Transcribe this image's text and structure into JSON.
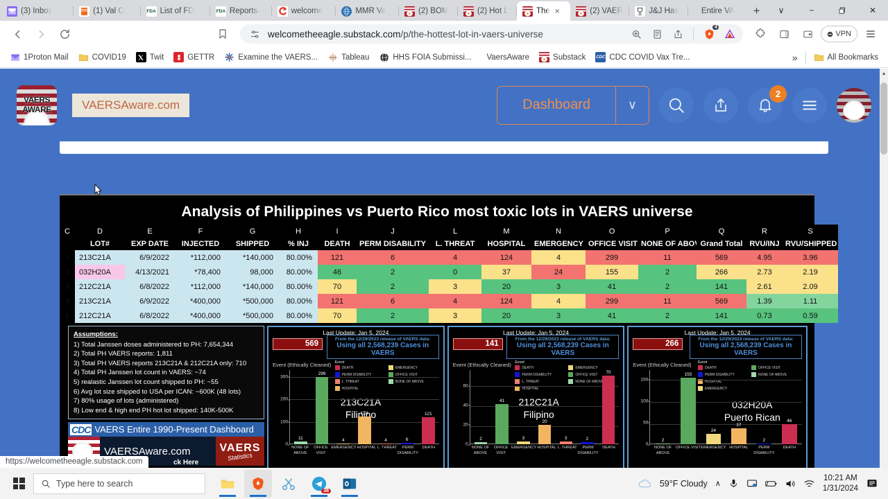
{
  "browser": {
    "tabs": [
      {
        "label": "(3) Inbox",
        "favicon": "proton-mail-icon",
        "color": "#8a6df0",
        "active": false
      },
      {
        "label": "(1) Val O",
        "favicon": "bookmark-icon",
        "color": "#f06a1e",
        "active": false
      },
      {
        "label": "List of FD",
        "favicon": "fda-icon",
        "color": "#1c6b3c",
        "active": false
      },
      {
        "label": "Reports-",
        "favicon": "fda-icon",
        "color": "#1c6b3c",
        "active": false
      },
      {
        "label": "welcome",
        "favicon": "substack-c-icon",
        "color": "#e03b2f",
        "active": false
      },
      {
        "label": "MMR Va",
        "favicon": "globe-icon",
        "color": "#2b6fb0",
        "active": false
      },
      {
        "label": "(2) BOM",
        "favicon": "eagle-icon",
        "color": "#8c3a1e",
        "active": false
      },
      {
        "label": "(2) Hot L",
        "favicon": "eagle-icon",
        "color": "#8c3a1e",
        "active": false
      },
      {
        "label": "The",
        "favicon": "eagle-icon",
        "color": "#8c3a1e",
        "active": true
      },
      {
        "label": "(2) VAER",
        "favicon": "eagle-icon",
        "color": "#8c3a1e",
        "active": false
      },
      {
        "label": "J&J Has",
        "favicon": "trophy-icon",
        "color": "#444444",
        "active": false
      },
      {
        "label": "Entire VA",
        "favicon": "none",
        "color": "#999999",
        "active": false
      }
    ],
    "tab_close_label": "×",
    "new_tab_label": "+",
    "window_controls": {
      "tablist": "∨",
      "minimize": "−",
      "restore": "❐",
      "close": "✕"
    },
    "nav": {
      "back": "‹",
      "forward": "›",
      "reload": "⟳",
      "bookmark": "🔖"
    },
    "omnibox": {
      "url_domain": "welcometheeagle.substack.com",
      "url_path": "/p/the-hottest-lot-in-vaers-universe",
      "permissions_icon": "tune-icon",
      "zoom_icon": "zoom-in-icon",
      "reading_icon": "reading-list-icon",
      "share_icon": "share-icon",
      "brave_shields_icon": "brave-lion-icon",
      "shields_count": "4",
      "extension_icon": "brave-triangle-icon"
    },
    "toolbar_right": {
      "extensions": "puzzle-icon",
      "sidebar": "sidebar-panel-icon",
      "wallet": "wallet-icon",
      "vpn_label": "VPN",
      "menu": "hamburger-menu-icon"
    },
    "bookmarks": [
      {
        "label": "1Proton Mail",
        "icon": "proton-mail-icon",
        "color": "#8a6df0"
      },
      {
        "label": "COVID19",
        "icon": "folder-icon",
        "color": "#f0c14b"
      },
      {
        "label": "Twit",
        "icon": "x-twitter-icon",
        "color": "#000000"
      },
      {
        "label": "GETTR",
        "icon": "gettr-icon",
        "color": "#e0242b"
      },
      {
        "label": "Examine the VAERS...",
        "icon": "asterisk-icon",
        "color": "#2b5fa8"
      },
      {
        "label": "Tableau",
        "icon": "tableau-icon",
        "color": "#e8762d"
      },
      {
        "label": "HHS FOIA Submissi...",
        "icon": "globe-icon",
        "color": "#2d2d2d"
      },
      {
        "label": "VaersAware",
        "icon": "none",
        "color": "#888888"
      },
      {
        "label": "Substack",
        "icon": "eagle-icon",
        "color": "#8c3a1e"
      },
      {
        "label": "CDC COVID Vax Tre...",
        "icon": "cdc-icon",
        "color": "#2b5fa8"
      }
    ],
    "bookmarks_overflow": "»",
    "all_bookmarks_label": "All Bookmarks",
    "status_url": "https://welcometheeagle.substack.com"
  },
  "site": {
    "publication_logo_text_line1": "VAERS",
    "publication_logo_text_line2": "AWARE",
    "link_tooltip": "VAERSAware.com",
    "dashboard_label": "Dashboard",
    "dashboard_caret": "∨",
    "search_icon": "search-icon",
    "share_icon": "share-up-icon",
    "bell_icon": "bell-icon",
    "bell_badge": "2",
    "menu_icon": "hamburger-menu-icon",
    "avatar": "user-avatar"
  },
  "infographic": {
    "title": "Analysis of Philippines vs Puerto Rico most toxic lots in VAERS universe",
    "column_letters": [
      "C",
      "D",
      "E",
      "F",
      "G",
      "H",
      "I",
      "J",
      "L",
      "M",
      "N",
      "O",
      "P",
      "Q",
      "R",
      "S"
    ],
    "column_headers": [
      "",
      "LOT#",
      "EXP DATE",
      "INJECTED",
      "SHIPPED",
      "% INJ",
      "DEATH",
      "PERM DISABILITY",
      "L. THREAT",
      "HOSPITAL",
      "EMERGENCY",
      "OFFICE VISIT",
      "NONE OF ABOVE",
      "Grand Total",
      "RVU/INJ",
      "RVU/SHIPPED"
    ],
    "rows": [
      {
        "num": "1",
        "lot": "213C21A",
        "exp": "6/9/2022",
        "injected": "*112,000",
        "shipped": "*140,000",
        "pct": "80.00%",
        "death": "121",
        "perm": "6",
        "lthreat": "4",
        "hospital": "124",
        "emergency": "4",
        "office": "299",
        "none": "11",
        "total": "569",
        "rvu_inj": "4.95",
        "rvu_ship": "3.96"
      },
      {
        "num": "2",
        "lot": "032H20A",
        "exp": "4/13/2021",
        "injected": "*78,400",
        "shipped": "98,000",
        "pct": "80.00%",
        "death": "46",
        "perm": "2",
        "lthreat": "0",
        "hospital": "37",
        "emergency": "24",
        "office": "155",
        "none": "2",
        "total": "266",
        "rvu_inj": "2.73",
        "rvu_ship": "2.19"
      },
      {
        "num": "3",
        "lot": "212C21A",
        "exp": "6/8/2022",
        "injected": "*112,000",
        "shipped": "*140,000",
        "pct": "80.00%",
        "death": "70",
        "perm": "2",
        "lthreat": "3",
        "hospital": "20",
        "emergency": "3",
        "office": "41",
        "none": "2",
        "total": "141",
        "rvu_inj": "2.61",
        "rvu_ship": "2.09"
      },
      {
        "num": "4",
        "lot": "213C21A",
        "exp": "6/9/2022",
        "injected": "*400,000",
        "shipped": "*500,000",
        "pct": "80.00%",
        "death": "121",
        "perm": "6",
        "lthreat": "4",
        "hospital": "124",
        "emergency": "4",
        "office": "299",
        "none": "11",
        "total": "569",
        "rvu_inj": "1.39",
        "rvu_ship": "1.11"
      },
      {
        "num": "5",
        "lot": "212C21A",
        "exp": "6/8/2022",
        "injected": "*400,000",
        "shipped": "*500,000",
        "pct": "80.00%",
        "death": "70",
        "perm": "2",
        "lthreat": "3",
        "hospital": "20",
        "emergency": "3",
        "office": "41",
        "none": "2",
        "total": "141",
        "rvu_inj": "0.73",
        "rvu_ship": "0.59"
      }
    ],
    "assumptions": {
      "heading": "Assumptions:",
      "items": [
        "1) Total Janssen doses administered to PH: 7,654,344",
        "2) Total PH VAERS reports:  1,811",
        "3) Total PH VAERS reports 213C21A & 212C21A only:  710",
        "4) Total PH Janssen lot count in VAERS: ~74",
        "5)  realastic Janssen lot count shipped to PH: ~55",
        "6) Avg lot size shipped to USA per ICAN: ~600K (48 lots)",
        "7) 80% usage of lots (administered)",
        "8)  Low end & high end PH hot lot shipped:  140K-500K"
      ]
    },
    "cdc_banner": {
      "cdc_logo": "CDC",
      "title": "VAERS Entire 1990-Present Dashboard",
      "site": "VAERSAware.com",
      "click_here": "ck Here",
      "stamp_line1": "VAERS",
      "stamp_line2": "Statistics"
    }
  },
  "chart_data": [
    {
      "type": "bar",
      "title": "213C21A",
      "subtitle": "Filipino",
      "total_badge": "569",
      "last_update": "Last Update: Jan 5, 2024",
      "source_line1": "From the 12/29/2023 release of VAERS data:",
      "source_line2": "Using all 2,568,239 Cases in VAERS",
      "ylabel": "Event (Ethically Cleaned)",
      "legend_title": "Event",
      "legend": [
        "DEATH",
        "PERM DISABILITY",
        "L. THREAT",
        "HOSPITAL",
        "EMERGENCY",
        "OFFICE VISIT",
        "NONE OF ABOVE"
      ],
      "categories": [
        "NONE OF ABOVE",
        "OFFICE VISIT",
        "EMERGENCY",
        "HOSPITAL",
        "L. THREAT",
        "PERM DISABILITY",
        "DEATH"
      ],
      "values": [
        11,
        299,
        4,
        124,
        4,
        6,
        121
      ],
      "colors": [
        "#9fd9ae",
        "#5aa95f",
        "#f0d87c",
        "#f2b562",
        "#f08070",
        "#1414d8",
        "#cc2e52"
      ],
      "ylim": [
        0,
        330
      ],
      "yticks": [
        0,
        100,
        200,
        300
      ]
    },
    {
      "type": "bar",
      "title": "212C21A",
      "subtitle": "Filipino",
      "total_badge": "141",
      "last_update": "Last Update: Jan 5, 2024",
      "source_line1": "From the 12/29/2023 release of VAERS data:",
      "source_line2": "Using all 2,568,239 Cases in VAERS",
      "ylabel": "Event (Ethically Cleaned)",
      "legend_title": "Event",
      "legend": [
        "DEATH",
        "PERM DISABILITY",
        "L. THREAT",
        "HOSPITAL",
        "EMERGENCY",
        "OFFICE VISIT",
        "NONE OF ABOVE"
      ],
      "categories": [
        "NONE OF ABOVE",
        "OFFICE VISIT",
        "EMERGENCY",
        "HOSPITAL",
        "L. THREAT",
        "PERM DISABILITY",
        "DEATH"
      ],
      "values": [
        2,
        41,
        3,
        20,
        3,
        2,
        70
      ],
      "colors": [
        "#9fd9ae",
        "#5aa95f",
        "#f0d87c",
        "#f2b562",
        "#f08070",
        "#1414d8",
        "#cc2e52"
      ],
      "ylim": [
        0,
        76
      ],
      "yticks": [
        0,
        20,
        40,
        60
      ]
    },
    {
      "type": "bar",
      "title": "032H20A",
      "subtitle": "Puerto Rican",
      "total_badge": "266",
      "last_update": "Last Update: Jan 5, 2024",
      "source_line1": "From the 12/29/2023 release of VAERS data:",
      "source_line2": "Using all 2,568,239 Cases in VAERS",
      "ylabel": "Event (Ethically Cleaned)",
      "legend_title": "Event",
      "legend": [
        "DEATH",
        "PERM DISABILITY",
        "HOSPITAL",
        "EMERGENCY",
        "OFFICE VISIT",
        "NONE OF ABOVE"
      ],
      "categories": [
        "NONE OF ABOVE",
        "OFFICE VISIT",
        "EMERGENCY",
        "HOSPITAL",
        "PERM DISABILITY",
        "DEATH"
      ],
      "values": [
        2,
        155,
        24,
        37,
        2,
        46
      ],
      "colors": [
        "#9fd9ae",
        "#5aa95f",
        "#f0d87c",
        "#f2b562",
        "#1414d8",
        "#cc2e52"
      ],
      "ylim": [
        0,
        172
      ],
      "yticks": [
        0,
        50,
        100,
        150
      ]
    }
  ],
  "taskbar": {
    "search_placeholder": "Type here to search",
    "search_icon": "magnifier-icon",
    "start_icon": "windows-start-icon",
    "apps": [
      {
        "name": "file-explorer-icon",
        "badge": ""
      },
      {
        "name": "brave-browser-icon",
        "badge": ""
      },
      {
        "name": "snipping-tool-icon",
        "badge": ""
      },
      {
        "name": "telegram-icon",
        "badge": "38"
      },
      {
        "name": "outlook-icon",
        "badge": ""
      }
    ],
    "weather": "59°F  Cloudy",
    "weather_icon": "cloud-icon",
    "tray_expand": "∧",
    "tray_icons": [
      "microphone-icon",
      "screen-cast-icon",
      "battery-icon",
      "volume-icon",
      "wifi-icon"
    ],
    "time": "10:21 AM",
    "date": "1/31/2024",
    "notifications_icon": "notification-icon"
  }
}
